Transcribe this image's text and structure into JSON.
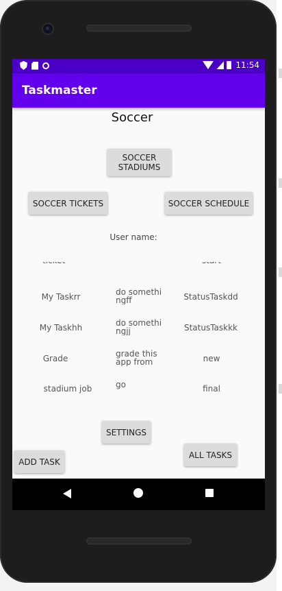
{
  "status_bar": {
    "time": "11:54"
  },
  "app_bar": {
    "title": "Taskmaster"
  },
  "page": {
    "title": "Soccer",
    "user_label": "User name:"
  },
  "buttons": {
    "stadiums": "SOCCER STADIUMS",
    "tickets": "SOCCER TICKETS",
    "schedule": "SOCCER SCHEDULE",
    "settings": "SETTINGS",
    "add_task": "ADD TASK",
    "all_tasks": "ALL TASKS"
  },
  "tasks_partial_top": {
    "title": "ticket",
    "state": "start"
  },
  "tasks": [
    {
      "title": "My Taskrr",
      "body": "do somethi ngff",
      "state": "StatusTaskdd"
    },
    {
      "title": "My Taskhh",
      "body": "do somethi ngjj",
      "state": "StatusTaskkk"
    },
    {
      "title": "Grade",
      "body": "grade this app from",
      "state": "new"
    },
    {
      "title": "stadium job",
      "body": "go",
      "state": "final"
    }
  ]
}
